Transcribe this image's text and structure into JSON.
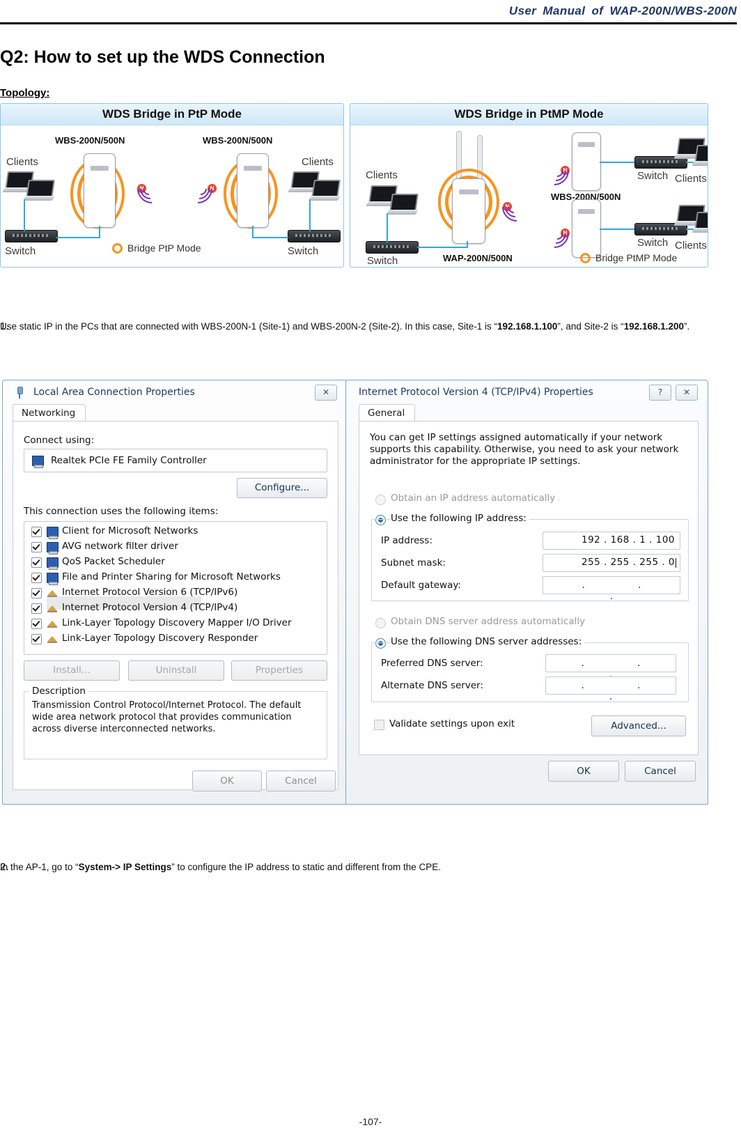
{
  "header": {
    "title": "User Manual of WAP-200N/WBS-200N"
  },
  "heading": {
    "q_title": "Q2: How to set up the WDS Connection",
    "topology_label": "Topology:"
  },
  "topology": {
    "ptp": {
      "title": "WDS Bridge in PtP Mode",
      "device_left": "WBS-200N/500N",
      "device_right": "WBS-200N/500N",
      "clients_left": "Clients",
      "clients_right": "Clients",
      "switch_left": "Switch",
      "switch_right": "Switch",
      "legend": "Bridge PtP Mode",
      "radio_badge": "N"
    },
    "ptmp": {
      "title": "WDS Bridge in PtMP Mode",
      "clients_left": "Clients",
      "switch_left": "Switch",
      "device_center": "WAP-200N/500N",
      "device_top": "WBS-200N/500N",
      "switch_top": "Switch",
      "clients_top": "Clients",
      "switch_bottom": "Switch",
      "clients_bottom": "Clients",
      "legend": "Bridge PtMP Mode",
      "radio_badge": "N"
    }
  },
  "steps": {
    "one": {
      "num": "1.",
      "text_a": "Use static IP in the PCs that are connected with WBS-200N-1 (Site-1) and WBS-200N-2 (Site-2). In this case, Site-1 is “",
      "ip_1": "192.168.1.100",
      "text_b": "”, and Site-2 is “",
      "ip_2": "192.168.1.200",
      "text_c": "”."
    },
    "two": {
      "num": "2.",
      "text_a": "In the AP-1, go to “",
      "bold": "System-> IP Settings",
      "text_b": "” to configure the IP address to static and different from the CPE."
    }
  },
  "lan_dialog": {
    "title": "Local Area Connection Properties",
    "close_icon": "✕",
    "tab": "Networking",
    "connect_using_label": "Connect using:",
    "adapter": "Realtek PCIe FE Family Controller",
    "configure_button": "Configure...",
    "items_label": "This connection uses the following items:",
    "items": [
      {
        "label": "Client for Microsoft Networks",
        "checked": true,
        "icon": "monitor-icon",
        "selected": false
      },
      {
        "label": "AVG network filter driver",
        "checked": true,
        "icon": "monitor-icon",
        "selected": false
      },
      {
        "label": "QoS Packet Scheduler",
        "checked": true,
        "icon": "monitor-icon",
        "selected": false
      },
      {
        "label": "File and Printer Sharing for Microsoft Networks",
        "checked": true,
        "icon": "monitor-icon",
        "selected": false
      },
      {
        "label": "Internet Protocol Version 6 (TCP/IPv6)",
        "checked": true,
        "icon": "protocol-icon",
        "selected": false
      },
      {
        "label": "Internet Protocol Version 4 (TCP/IPv4)",
        "checked": true,
        "icon": "protocol-icon",
        "selected": true
      },
      {
        "label": "Link-Layer Topology Discovery Mapper I/O Driver",
        "checked": true,
        "icon": "protocol-icon",
        "selected": false
      },
      {
        "label": "Link-Layer Topology Discovery Responder",
        "checked": true,
        "icon": "protocol-icon",
        "selected": false
      }
    ],
    "install_button": "Install...",
    "uninstall_button": "Uninstall",
    "properties_button": "Properties",
    "description_title": "Description",
    "description_text": "Transmission Control Protocol/Internet Protocol. The default wide area network protocol that provides communication across diverse interconnected networks.",
    "ok_button": "OK",
    "cancel_button": "Cancel"
  },
  "ipv4_dialog": {
    "title": "Internet Protocol Version 4 (TCP/IPv4) Properties",
    "help_icon": "?",
    "close_icon": "✕",
    "tab": "General",
    "intro": "You can get IP settings assigned automatically if your network supports this capability. Otherwise, you need to ask your network administrator for the appropriate IP settings.",
    "radio_auto_ip": {
      "label": "Obtain an IP address automatically",
      "selected": false
    },
    "radio_static_ip": {
      "label": "Use the following IP address:",
      "selected": true
    },
    "ip_address_label": "IP address:",
    "ip_address_value": "192 . 168 .  1  . 100",
    "subnet_mask_label": "Subnet mask:",
    "subnet_mask_value": "255 . 255 . 255 .  0",
    "default_gateway_label": "Default gateway:",
    "default_gateway_value": ".   .   .",
    "radio_auto_dns": {
      "label": "Obtain DNS server address automatically",
      "selected": false,
      "disabled": true
    },
    "radio_static_dns": {
      "label": "Use the following DNS server addresses:",
      "selected": true
    },
    "preferred_dns_label": "Preferred DNS server:",
    "preferred_dns_value": ".   .   .",
    "alternate_dns_label": "Alternate DNS server:",
    "alternate_dns_value": ".   .   .",
    "validate_checkbox": {
      "label": "Validate settings upon exit",
      "checked": false
    },
    "advanced_button": "Advanced...",
    "ok_button": "OK",
    "cancel_button": "Cancel"
  },
  "footer": {
    "page_number": "-107-"
  }
}
